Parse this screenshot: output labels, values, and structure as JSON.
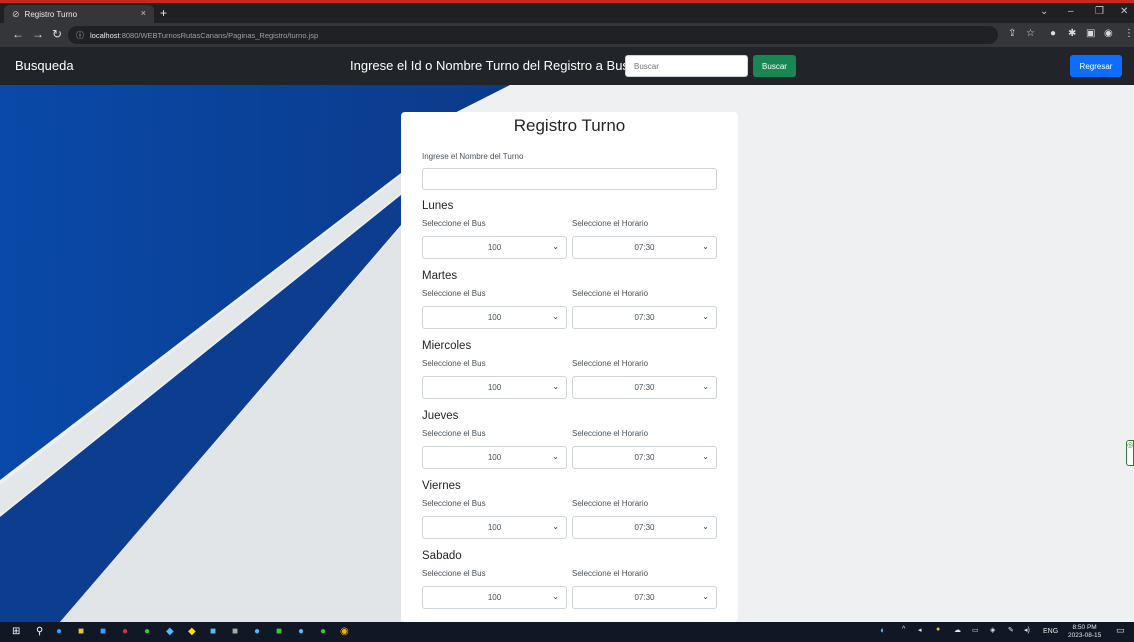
{
  "browser": {
    "tab_title": "Registro Turno",
    "tab_close": "×",
    "new_tab": "+",
    "url_host": "localhost",
    "url_rest": ":8080/WEBTurnosRutasCanans/Paginas_Registro/turno.jsp"
  },
  "nav": {
    "brand": "Busqueda",
    "search_label": "Ingrese el Id o Nombre Turno del Registro a Buscar",
    "search_placeholder": "Buscar",
    "search_button": "Buscar",
    "back_button": "Regresar"
  },
  "form": {
    "title": "Registro Turno",
    "name_label": "Ingrese el Nombre del Turno",
    "name_value": "",
    "bus_label": "Seleccione el Bus",
    "schedule_label": "Seleccione el Horario",
    "days": [
      {
        "name": "Lunes",
        "bus": "100",
        "time": "07:30"
      },
      {
        "name": "Martes",
        "bus": "100",
        "time": "07:30"
      },
      {
        "name": "Miercoles",
        "bus": "100",
        "time": "07:30"
      },
      {
        "name": "Jueves",
        "bus": "100",
        "time": "07:30"
      },
      {
        "name": "Viernes",
        "bus": "100",
        "time": "07:30"
      },
      {
        "name": "Sabado",
        "bus": "100",
        "time": "07:30"
      }
    ]
  },
  "taskbar": {
    "language": "ENG",
    "time": "8:50 PM",
    "date": "2023-08-15"
  },
  "colors": {
    "navbar": "#212529",
    "success": "#198754",
    "primary": "#0d6efd",
    "art_blue": "#0b3a8a"
  }
}
